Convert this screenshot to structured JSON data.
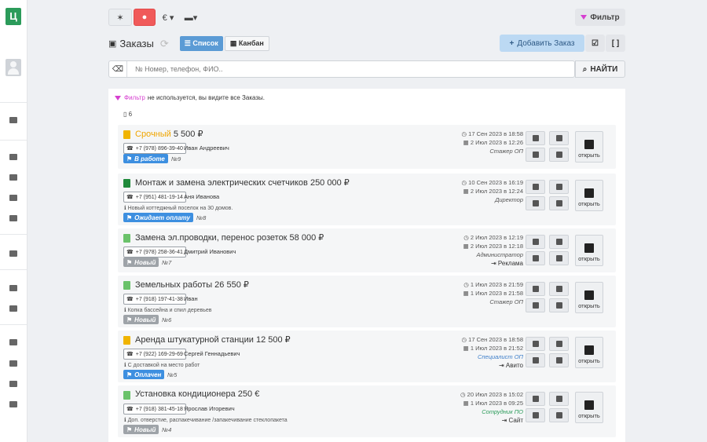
{
  "sidebar": {
    "logo": "Ц"
  },
  "topbar": {
    "currency": "€ ▾",
    "filter_label": "Фильтр"
  },
  "header": {
    "title": "Заказы",
    "view_list": "☰ Список",
    "view_kanban": "▦ Канбан",
    "add_label": "Добавить Заказ"
  },
  "search": {
    "placeholder": "№ Номер, телефон, ФИО..",
    "button": "НАЙТИ"
  },
  "notice": {
    "filter_word": "Фильтр",
    "rest": "не используется, вы видите все Заказы."
  },
  "count": "6",
  "orders": [
    {
      "icon": "!",
      "title_a": "Срочный",
      "title_b": "5 500 ₽",
      "phone": "+7 (978) 896-39-40",
      "name": "Иван Андреевич",
      "note": "",
      "status": "В работе",
      "num": "№9",
      "d1": "◷ 17 Сен 2023 в 18:58",
      "d2": "▦ 2 Июл 2023 в 12:26",
      "role": "Стажер ОП",
      "source": ""
    },
    {
      "icon": "doc",
      "title_a": "Монтаж и замена электрических счетчиков 250 000 ₽",
      "title_b": "",
      "phone": "+7 (951) 481-19-14",
      "name": "Аня Иванова",
      "note": "ℹ Новый коттеджный поселок на 30 домов.",
      "status": "Ожидает оплату",
      "num": "№8",
      "d1": "◷ 10 Сен 2023 в 16:19",
      "d2": "▦ 2 Июл 2023 в 12:24",
      "role": "Директор",
      "source": ""
    },
    {
      "icon": "doc",
      "title_a": "Замена эл.проводки, перенос розеток 58 000 ₽",
      "title_b": "",
      "phone": "+7 (978) 258-36-41",
      "name": "Дмитрий Иванович",
      "note": "",
      "status": "Новый",
      "num": "№7",
      "d1": "◷ 2 Июл 2023 в 12:19",
      "d2": "▦ 2 Июл 2023 в 12:18",
      "role": "Администратор",
      "source": "⇥ Реклама"
    },
    {
      "icon": "doc",
      "title_a": "Земельных работы 26 550 ₽",
      "title_b": "",
      "phone": "+7 (918) 197-41-38",
      "name": "Иван",
      "note": "ℹ Копка бассейна и спил деревьев",
      "status": "Новый",
      "num": "№6",
      "d1": "◷ 1 Июл 2023 в 21:59",
      "d2": "▦ 1 Июл 2023 в 21:58",
      "role": "Стажер ОП",
      "source": ""
    },
    {
      "icon": "!",
      "title_a": "Аренда штукатурной станции 12 500 ₽",
      "title_b": "",
      "phone": "+7 (922) 169-29-69",
      "name": "Сергей Геннадьевич",
      "note": "ℹ С доставкой на место работ",
      "status": "Оплачен",
      "num": "№5",
      "d1": "◷ 17 Сен 2023 в 18:58",
      "d2": "▦ 1 Июл 2023 в 21:52",
      "role": "Специалист ОП",
      "source": "⇥ Авито"
    },
    {
      "icon": "doc",
      "title_a": "Установка кондиционера 250 €",
      "title_b": "",
      "phone": "+7 (918) 381-45-18",
      "name": "Ярослав Игоревич",
      "note": "ℹ Доп. отверстие, распакечивание /запакечивание стеклопакета",
      "status": "Новый",
      "num": "№4",
      "d1": "◷ 20 Июл 2023 в 15:02",
      "d2": "▦ 1 Июл 2023 в 09:25",
      "role": "Сотрудник ПО",
      "source": "⇥ Сайт"
    }
  ],
  "open_label": "открыть"
}
